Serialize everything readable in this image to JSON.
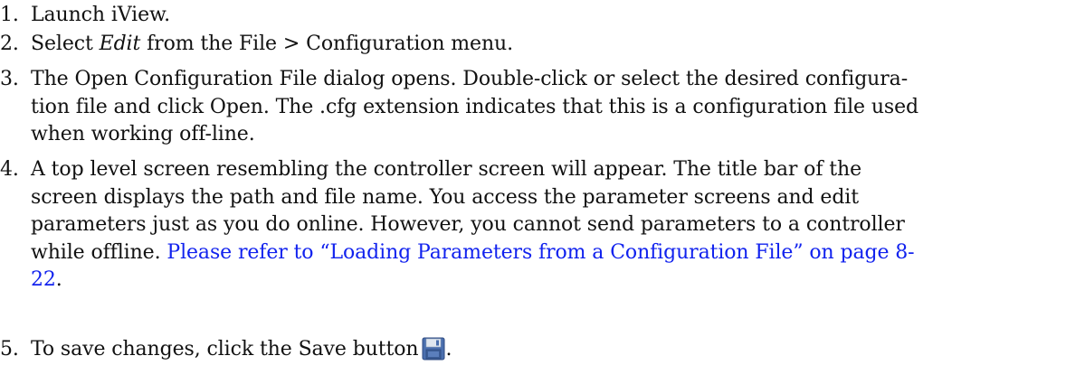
{
  "steps": [
    {
      "number": "1.",
      "text": "Launch iView."
    },
    {
      "number": "2.",
      "before": "Select ",
      "emphasis": "Edit",
      "after": " from the File > Configuration menu."
    },
    {
      "number": "3.",
      "lines": [
        "The Open Configuration File dialog opens. Double-click or select the desired configura-",
        "tion file and click Open. The .cfg extension indicates that this is a configuration file used",
        "when working off-line."
      ]
    },
    {
      "number": "4.",
      "lines": [
        "A top level screen resembling the controller screen will appear. The title bar of the",
        "screen displays the path and file name. You access the parameter screens and edit",
        "parameters just as you do online. However, you cannot send parameters to a controller"
      ],
      "line4_before": "while offline. ",
      "link_part1": "Please refer to “Loading Parameters from a Configuration File” on page 8-",
      "link_part2": "22",
      "after_link": "."
    },
    {
      "number": "5.",
      "text": "To save changes, click the Save button",
      "after_icon": ".",
      "icon": "save-icon"
    }
  ]
}
